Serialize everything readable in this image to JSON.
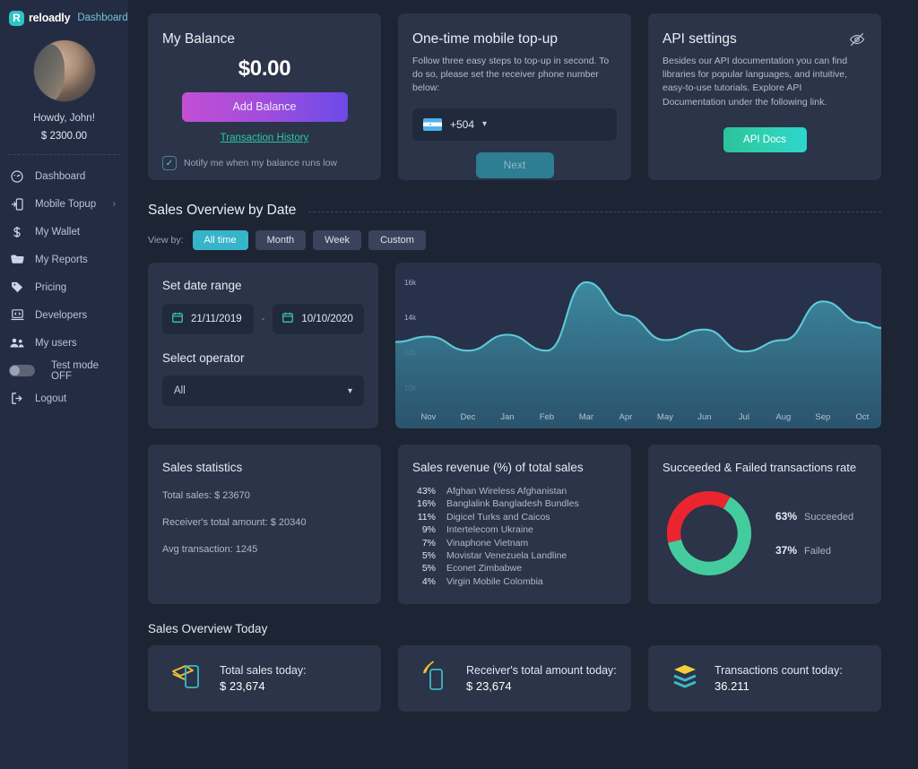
{
  "brand": {
    "name": "reloadly",
    "sub": "Dashboard",
    "mark": "R"
  },
  "profile": {
    "greeting": "Howdy, John!",
    "balance": "$ 2300.00"
  },
  "sidebar": {
    "items": [
      {
        "label": "Dashboard",
        "icon": "gauge-icon"
      },
      {
        "label": "Mobile Topup",
        "icon": "topup-icon",
        "chevron": "›"
      },
      {
        "label": "My Wallet",
        "icon": "dollar-icon"
      },
      {
        "label": "My Reports",
        "icon": "folder-icon"
      },
      {
        "label": "Pricing",
        "icon": "tag-icon"
      },
      {
        "label": "Developers",
        "icon": "laptop-code-icon"
      },
      {
        "label": "My users",
        "icon": "users-icon"
      },
      {
        "label": "Test mode OFF",
        "icon": "toggle-off-icon"
      },
      {
        "label": "Logout",
        "icon": "logout-icon"
      }
    ]
  },
  "balance_card": {
    "title": "My Balance",
    "amount": "$0.00",
    "add_button": "Add Balance",
    "history_link": "Transaction History",
    "notify_label": "Notify me when my balance runs low",
    "notify_checked": true
  },
  "topup_card": {
    "title": "One-time mobile top-up",
    "description": "Follow three easy steps to top-up in second. To do so, please set the receiver phone number below:",
    "dial_code": "+504",
    "flag": "honduras-flag-icon",
    "next_button": "Next"
  },
  "api_card": {
    "title": "API settings",
    "description": "Besides our API documentation you can find libraries for popular languages, and intuitive, easy-to-use tutorials. Explore API Documentation under the following link.",
    "docs_button": "API Docs",
    "hide_icon": "eye-off-icon"
  },
  "sales_overview": {
    "title": "Sales Overview by Date",
    "view_by_label": "View by:",
    "filters": [
      {
        "label": "All time",
        "active": true
      },
      {
        "label": "Month",
        "active": false
      },
      {
        "label": "Week",
        "active": false
      },
      {
        "label": "Custom",
        "active": false
      }
    ]
  },
  "date_range": {
    "title": "Set date range",
    "start": "21/11/2019",
    "separator": "-",
    "end": "10/10/2020",
    "operator_title": "Select operator",
    "operator_value": "All"
  },
  "chart_data": {
    "type": "area",
    "title": "",
    "xlabel": "",
    "ylabel": "",
    "categories": [
      "Nov",
      "Dec",
      "Jan",
      "Feb",
      "Mar",
      "Apr",
      "May",
      "Jun",
      "Jul",
      "Aug",
      "Sep",
      "Oct"
    ],
    "values": [
      12900,
      12100,
      13000,
      12100,
      16000,
      14100,
      12700,
      13300,
      12050,
      12700,
      14900,
      13700
    ],
    "ytick_labels": [
      "16k",
      "14k",
      "12k",
      "10k"
    ],
    "ytick_values": [
      16000,
      14000,
      12000,
      10000
    ],
    "ylim": [
      9200,
      16600
    ],
    "grid": false,
    "legend": "none",
    "line_color": "#5fc9d6",
    "fill_color": "#2f6d83"
  },
  "stats_card": {
    "title": "Sales statistics",
    "lines": [
      "Total sales: $ 23670",
      "Receiver's total amount: $ 20340",
      "Avg transaction: 1245"
    ]
  },
  "revenue_card": {
    "title": "Sales revenue (%) of total sales",
    "rows": [
      {
        "pct": "43%",
        "name": "Afghan Wireless Afghanistan"
      },
      {
        "pct": "16%",
        "name": "Banglalink Bangladesh Bundles"
      },
      {
        "pct": "11%",
        "name": "Digicel Turks and Caicos"
      },
      {
        "pct": "9%",
        "name": "Intertelecom Ukraine"
      },
      {
        "pct": "7%",
        "name": "Vinaphone Vietnam"
      },
      {
        "pct": "5%",
        "name": "Movistar Venezuela Landline"
      },
      {
        "pct": "5%",
        "name": "Econet Zimbabwe"
      },
      {
        "pct": "4%",
        "name": "Virgin Mobile Colombia"
      }
    ]
  },
  "donut_card": {
    "title": "Succeeded & Failed transactions rate",
    "chart": {
      "type": "pie",
      "slices": [
        {
          "label": "Succeeded",
          "value": 63,
          "color": "#45cc9e"
        },
        {
          "label": "Failed",
          "value": 37,
          "color": "#ea2530"
        }
      ]
    },
    "legend": [
      {
        "pct": "63%",
        "label": "Succeeded"
      },
      {
        "pct": "37%",
        "label": "Failed"
      }
    ]
  },
  "today": {
    "title": "Sales Overview Today",
    "cards": [
      {
        "icon": "money-phone-icon",
        "label": "Total sales today:",
        "value": "$ 23,674"
      },
      {
        "icon": "phone-signal-icon",
        "label": "Receiver's total amount today:",
        "value": "$ 23,674"
      },
      {
        "icon": "layers-icon",
        "label": "Transactions count today:",
        "value": "36.211"
      }
    ]
  },
  "colors": {
    "page_bg": "#1d2433",
    "sidebar_bg": "#232c42",
    "card_bg": "#2b3448",
    "accent_teal": "#36b4c9",
    "accent_green": "#2ec5a8",
    "link": "#2ec5a8"
  }
}
